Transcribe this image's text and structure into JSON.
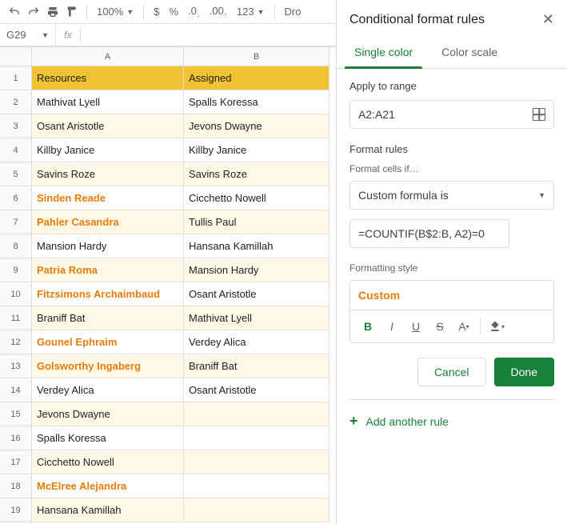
{
  "toolbar": {
    "zoom": "100%",
    "currency": "$",
    "percent": "%",
    "dec_dec": ".0",
    "dec_inc": ".00",
    "num_format": "123",
    "font_trunc": "Dro"
  },
  "namebox": "G29",
  "fx_label": "fx",
  "columns": [
    "A",
    "B"
  ],
  "rows": [
    {
      "n": 1,
      "a": "Resources",
      "b": "Assigned",
      "header": true
    },
    {
      "n": 2,
      "a": "Mathivat Lyell",
      "b": "Spalls Koressa"
    },
    {
      "n": 3,
      "a": "Osant Aristotle",
      "b": "Jevons Dwayne",
      "striped": true
    },
    {
      "n": 4,
      "a": "Killby Janice",
      "b": "Killby Janice"
    },
    {
      "n": 5,
      "a": "Savins Roze",
      "b": "Savins Roze",
      "striped": true
    },
    {
      "n": 6,
      "a": "Sinden Reade",
      "b": "Cicchetto Nowell",
      "hl": true
    },
    {
      "n": 7,
      "a": "Pahler Casandra",
      "b": "Tullis Paul",
      "striped": true,
      "hl": true
    },
    {
      "n": 8,
      "a": "Mansion Hardy",
      "b": "Hansana Kamillah"
    },
    {
      "n": 9,
      "a": "Patria Roma",
      "b": "Mansion Hardy",
      "striped": true,
      "hl": true
    },
    {
      "n": 10,
      "a": "Fitzsimons Archaimbaud",
      "b": "Osant Aristotle",
      "hl": true
    },
    {
      "n": 11,
      "a": "Braniff Bat",
      "b": "Mathivat Lyell",
      "striped": true
    },
    {
      "n": 12,
      "a": "Gounel Ephraim",
      "b": "Verdey Alica",
      "hl": true
    },
    {
      "n": 13,
      "a": "Golsworthy Ingaberg",
      "b": "Braniff Bat",
      "striped": true,
      "hl": true
    },
    {
      "n": 14,
      "a": "Verdey Alica",
      "b": "Osant Aristotle"
    },
    {
      "n": 15,
      "a": "Jevons Dwayne",
      "b": "",
      "striped": true
    },
    {
      "n": 16,
      "a": "Spalls Koressa",
      "b": ""
    },
    {
      "n": 17,
      "a": "Cicchetto Nowell",
      "b": "",
      "striped": true
    },
    {
      "n": 18,
      "a": "McElree Alejandra",
      "b": "",
      "hl": true
    },
    {
      "n": 19,
      "a": "Hansana Kamillah",
      "b": "",
      "striped": true
    }
  ],
  "panel": {
    "title": "Conditional format rules",
    "tabs": {
      "single": "Single color",
      "scale": "Color scale"
    },
    "apply_label": "Apply to range",
    "range": "A2:A21",
    "rules_label": "Format rules",
    "cells_if": "Format cells if…",
    "condition": "Custom formula is",
    "formula": "=COUNTIF(B$2:B, A2)=0",
    "style_label": "Formatting style",
    "style_preview": "Custom",
    "cancel": "Cancel",
    "done": "Done",
    "add_rule": "Add another rule"
  }
}
